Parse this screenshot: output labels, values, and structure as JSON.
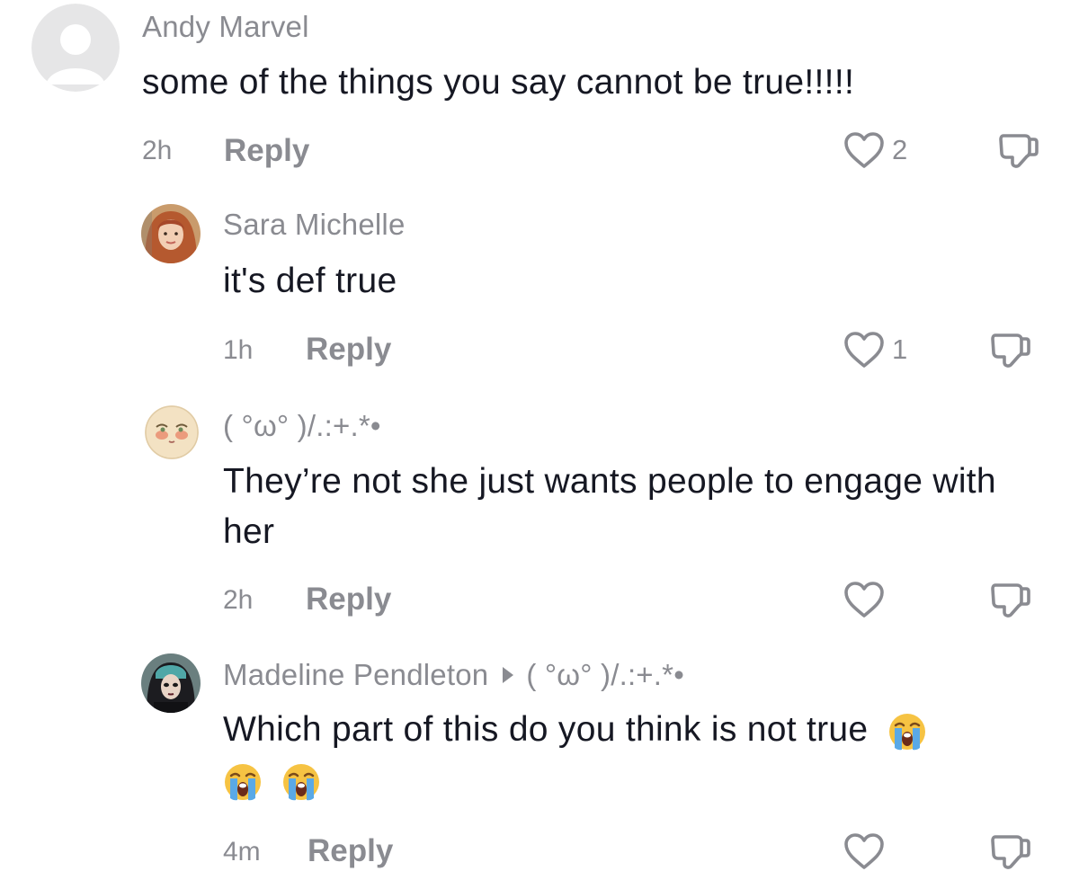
{
  "comments": [
    {
      "username": "Andy Marvel",
      "text": "some of the things you say cannot be true!!!!!",
      "time": "2h",
      "reply_label": "Reply",
      "likes": "2"
    },
    {
      "username": "Sara Michelle",
      "text": "it's def true",
      "time": "1h",
      "reply_label": "Reply",
      "likes": "1"
    },
    {
      "username": "( °ω° )/.:+.*•",
      "text": "They’re not she just wants people to engage with her",
      "time": "2h",
      "reply_label": "Reply",
      "likes": ""
    },
    {
      "username": "Madeline Pendleton",
      "reply_to": "( °ω° )/.:+.*•",
      "text": "Which part of this do you think is not true",
      "emojis": [
        "loudly-crying-face",
        "loudly-crying-face",
        "loudly-crying-face"
      ],
      "time": "4m",
      "reply_label": "Reply",
      "likes": ""
    }
  ],
  "icons": {
    "like": "heart-outline-icon",
    "dislike": "thumbs-down-outline-icon",
    "reply_arrow": "triangle-right-icon"
  },
  "colors": {
    "primary_text": "#161823",
    "secondary_text": "#8a8b91",
    "background": "#ffffff"
  }
}
